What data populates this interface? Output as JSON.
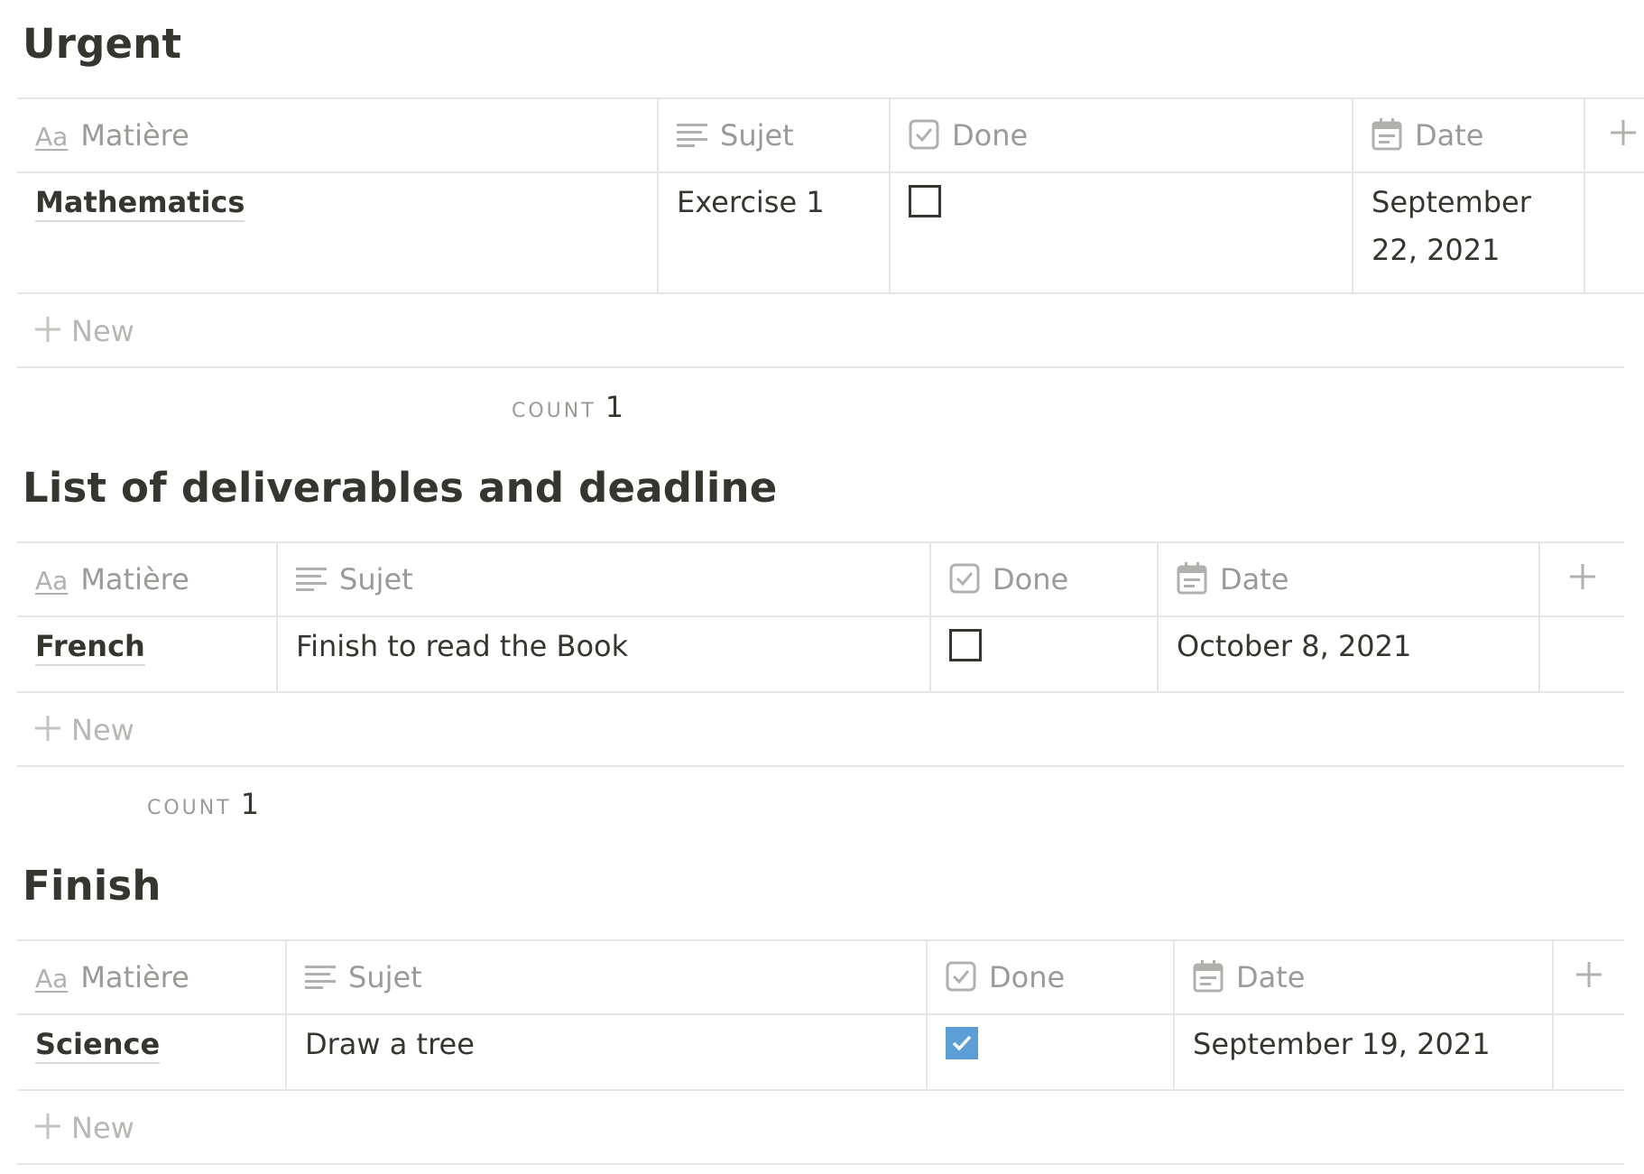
{
  "columns": {
    "matiere": "Matière",
    "sujet": "Sujet",
    "done": "Done",
    "date": "Date"
  },
  "icons": {
    "title_property": "Aa",
    "text_property": "text-lines-icon",
    "checkbox_property": "checkbox-icon",
    "date_property": "calendar-icon",
    "add_property": "plus-icon"
  },
  "new_label": "New",
  "count_label": "COUNT",
  "colors": {
    "text": "#37352f",
    "muted": "#9b9a97",
    "border": "#e6e6e4",
    "checked": "#5c9fd6"
  },
  "tables": [
    {
      "title": "Urgent",
      "rows": [
        {
          "matiere": "Mathematics",
          "sujet": "Exercise 1",
          "done": false,
          "date": "September 22, 2021"
        }
      ],
      "count": "1"
    },
    {
      "title": "List of deliverables and deadline",
      "rows": [
        {
          "matiere": "French",
          "sujet": "Finish to read the Book",
          "done": false,
          "date": "October 8, 2021"
        }
      ],
      "count": "1"
    },
    {
      "title": "Finish",
      "rows": [
        {
          "matiere": "Science",
          "sujet": "Draw a tree",
          "done": true,
          "date": "September 19, 2021"
        }
      ]
    }
  ]
}
